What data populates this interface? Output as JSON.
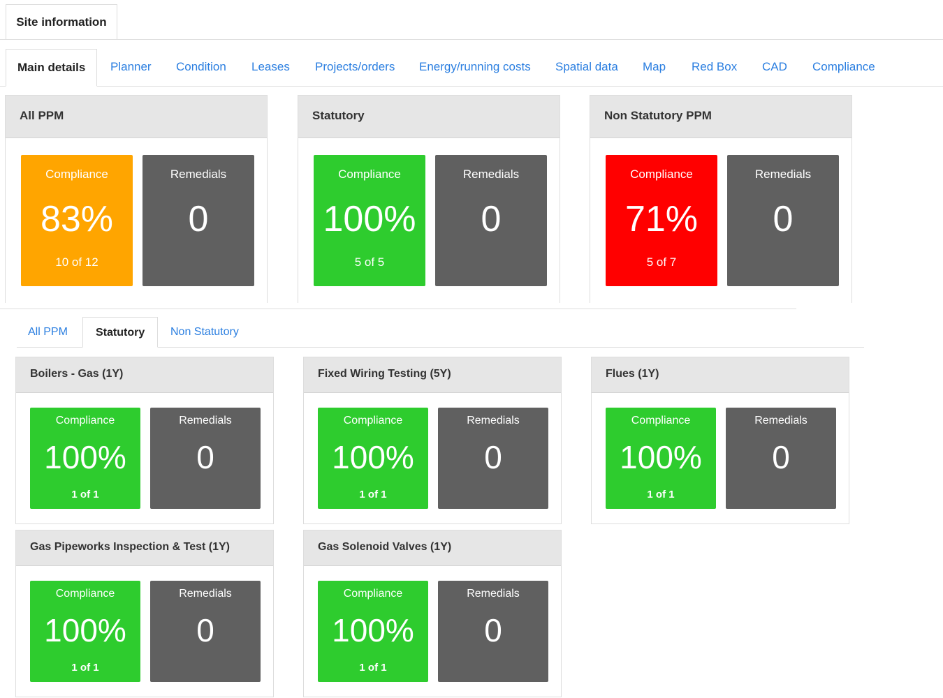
{
  "site_tab": {
    "label": "Site information"
  },
  "main_tabs": [
    {
      "label": "Main details",
      "active": true
    },
    {
      "label": "Planner"
    },
    {
      "label": "Condition"
    },
    {
      "label": "Leases"
    },
    {
      "label": "Projects/orders"
    },
    {
      "label": "Energy/running costs"
    },
    {
      "label": "Spatial data"
    },
    {
      "label": "Map"
    },
    {
      "label": "Red Box"
    },
    {
      "label": "CAD"
    },
    {
      "label": "Compliance"
    }
  ],
  "colors": {
    "green": "#2ecc2e",
    "orange": "#ffa500",
    "red": "#ff0000",
    "grey": "#606060",
    "link": "#2a7ee0"
  },
  "summary": [
    {
      "title": "All PPM",
      "compliance_label": "Compliance",
      "compliance_value": "83%",
      "compliance_sub": "10 of 12",
      "status": "orange",
      "remedials_label": "Remedials",
      "remedials_value": "0"
    },
    {
      "title": "Statutory",
      "compliance_label": "Compliance",
      "compliance_value": "100%",
      "compliance_sub": "5 of 5",
      "status": "green",
      "remedials_label": "Remedials",
      "remedials_value": "0"
    },
    {
      "title": "Non Statutory PPM",
      "compliance_label": "Compliance",
      "compliance_value": "71%",
      "compliance_sub": "5 of 7",
      "status": "red",
      "remedials_label": "Remedials",
      "remedials_value": "0"
    }
  ],
  "sub_tabs": [
    {
      "label": "All PPM"
    },
    {
      "label": "Statutory",
      "active": true
    },
    {
      "label": "Non Statutory"
    }
  ],
  "cards": [
    {
      "title": "Boilers - Gas (1Y)",
      "compliance_label": "Compliance",
      "compliance_value": "100%",
      "compliance_sub": "1 of 1",
      "status": "green",
      "remedials_label": "Remedials",
      "remedials_value": "0"
    },
    {
      "title": "Fixed Wiring Testing (5Y)",
      "compliance_label": "Compliance",
      "compliance_value": "100%",
      "compliance_sub": "1 of 1",
      "status": "green",
      "remedials_label": "Remedials",
      "remedials_value": "0"
    },
    {
      "title": "Flues (1Y)",
      "compliance_label": "Compliance",
      "compliance_value": "100%",
      "compliance_sub": "1 of 1",
      "status": "green",
      "remedials_label": "Remedials",
      "remedials_value": "0"
    },
    {
      "title": "Gas Pipeworks Inspection & Test (1Y)",
      "compliance_label": "Compliance",
      "compliance_value": "100%",
      "compliance_sub": "1 of 1",
      "status": "green",
      "remedials_label": "Remedials",
      "remedials_value": "0"
    },
    {
      "title": "Gas Solenoid Valves (1Y)",
      "compliance_label": "Compliance",
      "compliance_value": "100%",
      "compliance_sub": "1 of 1",
      "status": "green",
      "remedials_label": "Remedials",
      "remedials_value": "0"
    }
  ]
}
